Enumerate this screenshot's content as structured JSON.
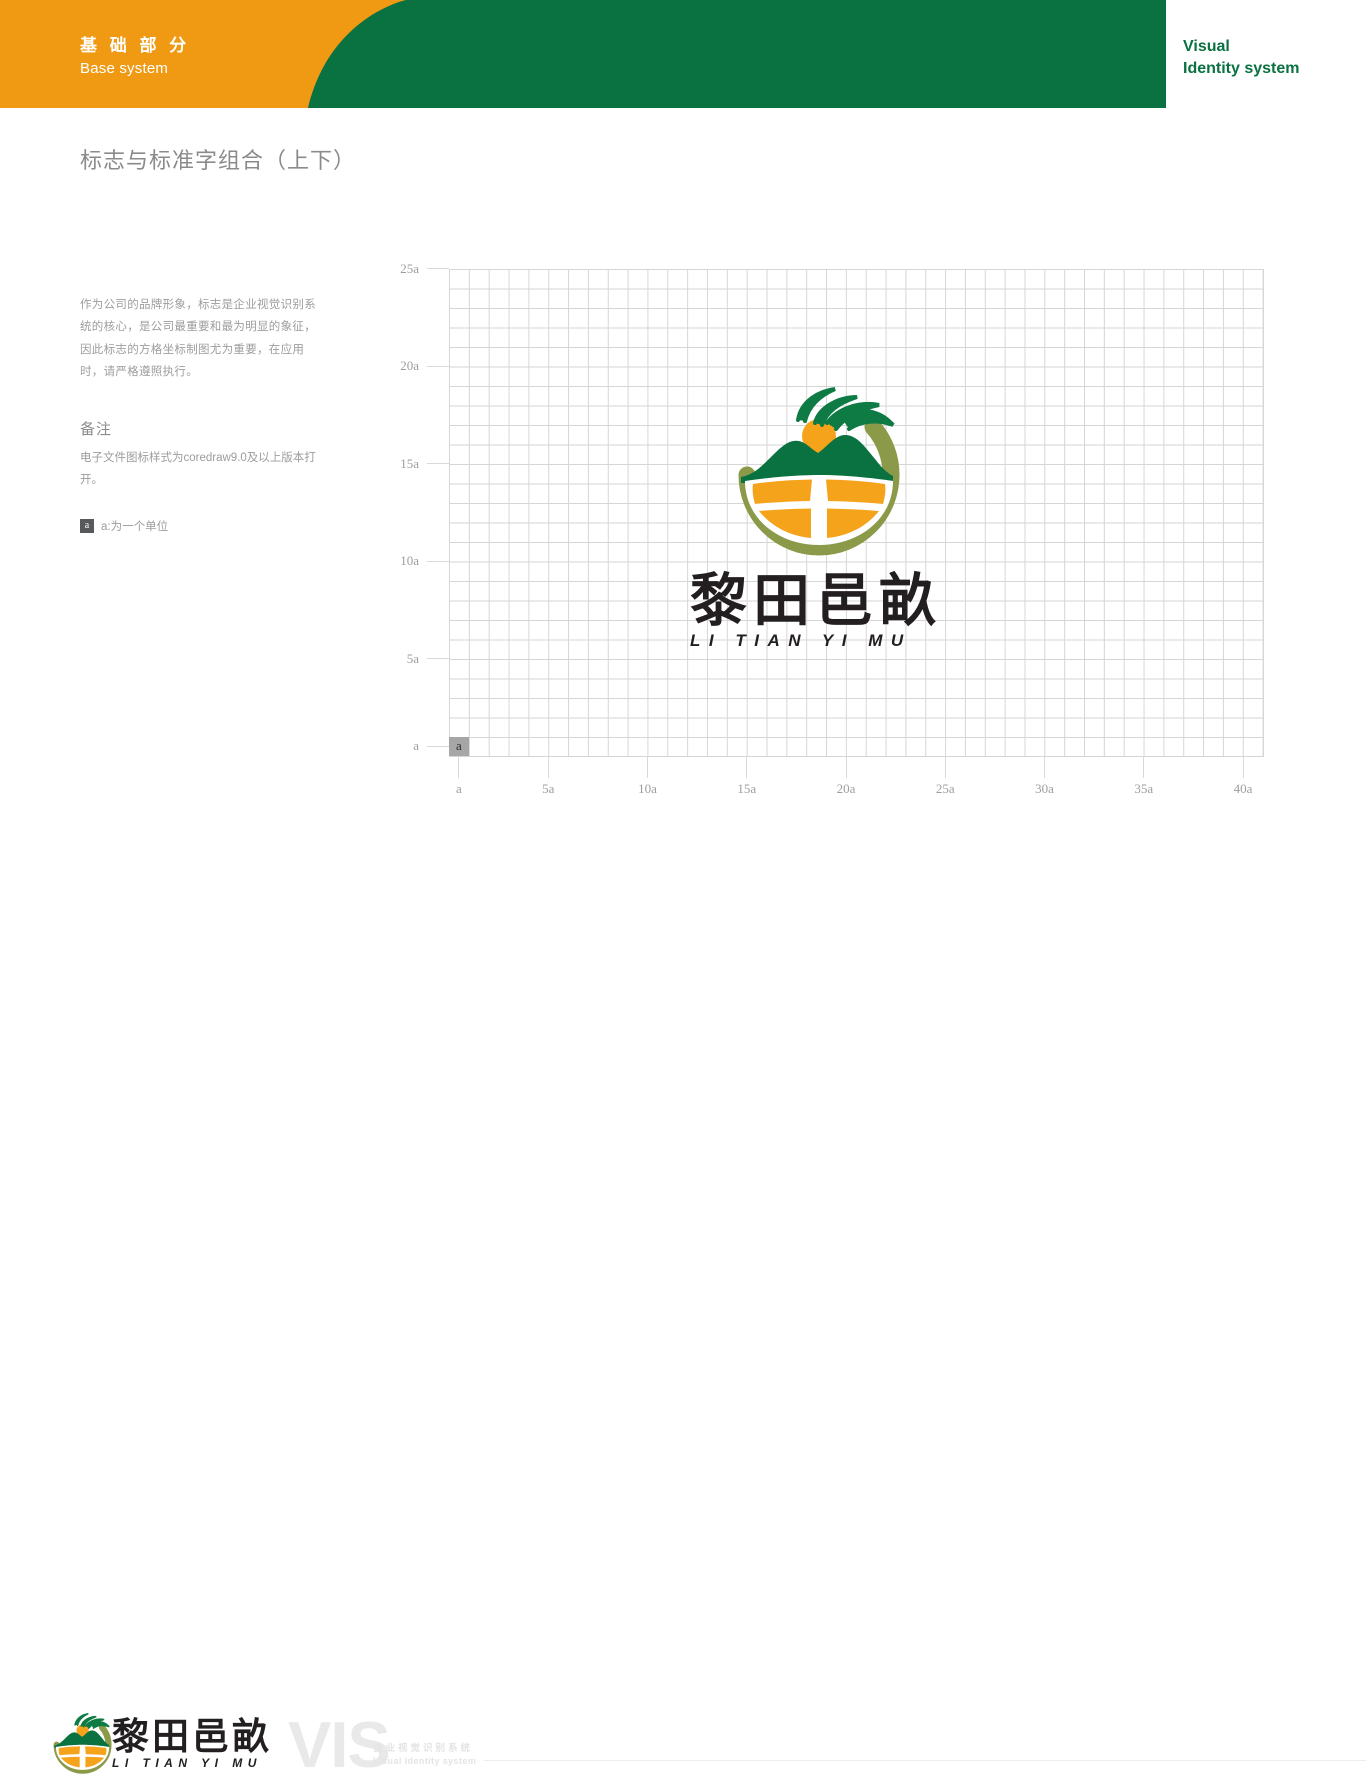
{
  "header": {
    "left_cn": "基 础 部 分",
    "left_en": "Base system",
    "right_line1": "Visual",
    "right_line2": "Identity system",
    "orange": "#f09a14",
    "green": "#0a7140"
  },
  "page_title": "标志与标准字组合（上下）",
  "sidebar": {
    "intro": "作为公司的品牌形象，标志是企业视觉识别系统的核心，是公司最重要和最为明显的象征，因此标志的方格坐标制图尤为重要，在应用时，请严格遵照执行。",
    "note_title": "备注",
    "note_body": "电子文件图标样式为coredraw9.0及以上版本打开。",
    "legend_badge": "a",
    "legend_text": "a:为一个单位"
  },
  "grid": {
    "unit_cell_label": "a",
    "x_labels": [
      "a",
      "5a",
      "10a",
      "15a",
      "20a",
      "25a",
      "30a",
      "35a",
      "40a"
    ],
    "y_labels": [
      "a",
      "5a",
      "10a",
      "15a",
      "20a",
      "25a"
    ],
    "columns": 41,
    "rows": 25,
    "line_color": "#d6d6d6",
    "unit_cell_fill": "#a6a6a6"
  },
  "logo": {
    "wordmark_cn": "黎田邑畝",
    "wordmark_en": "LI TIAN YI MU",
    "colors": {
      "sun_orange": "#f5a31b",
      "field_orange": "#f5a31b",
      "mountain_green": "#0a7140",
      "ring_olive": "#8a9a48",
      "sprout_green": "#0e7a44"
    }
  },
  "footer": {
    "wordmark_cn": "黎田邑畝",
    "wordmark_en": "LI TIAN YI MU",
    "vis_mark": "VIS",
    "vis_sub_cn": "企业视觉识别系统",
    "vis_sub_en": "Visual Identity system"
  }
}
